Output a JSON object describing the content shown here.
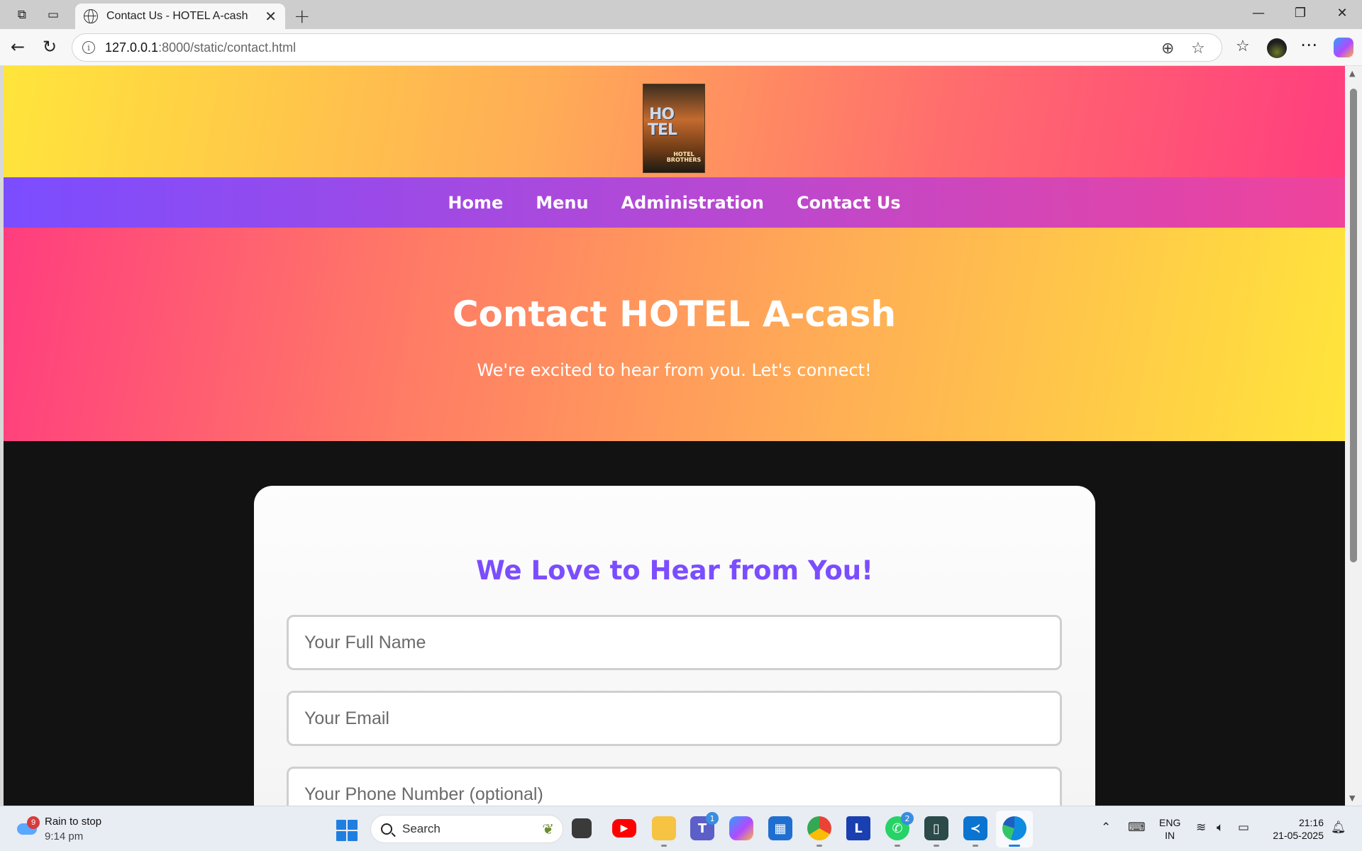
{
  "browser": {
    "tab_title": "Contact Us - HOTEL A-cash",
    "url_host": "127.0.0.1",
    "url_rest": ":8000/static/contact.html"
  },
  "site": {
    "logo_text_1": "HO",
    "logo_text_2": "TEL",
    "logo_text_3": "HOTEL BROTHERS",
    "nav": [
      "Home",
      "Menu",
      "Administration",
      "Contact Us"
    ],
    "hero_title": "Contact HOTEL A-cash",
    "hero_subtitle": "We're excited to hear from you. Let's connect!",
    "form_heading": "We Love to Hear from You!",
    "placeholders": {
      "name": "Your Full Name",
      "email": "Your Email",
      "phone": "Your Phone Number (optional)"
    }
  },
  "taskbar": {
    "weather_badge": "9",
    "weather_title": "Rain to stop",
    "weather_time": "9:14 pm",
    "search_label": "Search",
    "teams_badge": "1",
    "whatsapp_badge": "2",
    "lang_1": "ENG",
    "lang_2": "IN",
    "clock_time": "21:16",
    "clock_date": "21-05-2025"
  },
  "colors": {
    "nav_gradient_start": "#7b4dff",
    "nav_gradient_end": "#f0439a",
    "form_heading": "#7b4dff",
    "header_yellow": "#ffe53b",
    "header_pink": "#ff3d7f"
  }
}
